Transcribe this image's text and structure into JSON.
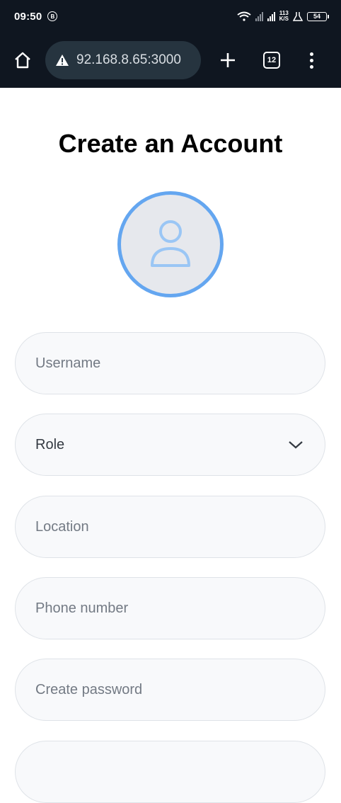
{
  "status": {
    "time": "09:50",
    "b_badge": "B",
    "network_speed_top": "113",
    "network_speed_bottom": "K/S",
    "battery": "54"
  },
  "browser": {
    "url": "92.168.8.65:3000",
    "tab_count": "12"
  },
  "form": {
    "title": "Create an Account",
    "username_placeholder": "Username",
    "role_selected": "Role",
    "location_placeholder": "Location",
    "phone_placeholder": "Phone number",
    "password_placeholder": "Create password",
    "confirm_placeholder": ""
  },
  "colors": {
    "avatar_ring": "#64a6f0",
    "avatar_bg": "#e6e8ed",
    "browser_bar": "#0f1620"
  }
}
